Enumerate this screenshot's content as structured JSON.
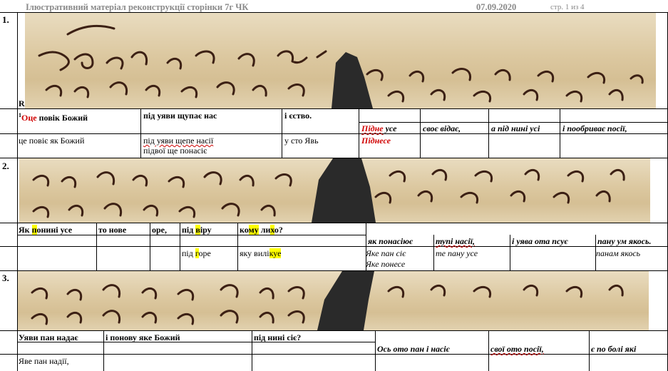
{
  "header": {
    "title": "Ілюстративний матеріал реконструкції сторінки 7г  ЧК",
    "date": "07.09.2020",
    "page": "стр. 1 из 4"
  },
  "sections": [
    {
      "number": "1.",
      "marker": "R",
      "row1": {
        "sup": "1",
        "c1_red": "Оце",
        "c1_rest": " повік Божий",
        "c2": "під уяви щупає нас",
        "c3": "і єство."
      },
      "row2_it": {
        "c1_red": "Підне",
        "c1_rest": " усе",
        "c2": "своє відає,",
        "c3": "а під нині усі",
        "c4": "і пообриває посії,"
      },
      "row3": {
        "c1": "це повіє як Божий",
        "c2_a": "під уяви щепе насії",
        "c2_b": "підвої ще понасіє",
        "c3": "у сто Явь",
        "c4_red": "Піднесе"
      }
    },
    {
      "number": "2.",
      "row1": {
        "c1_a": "Як ",
        "c1_hl": "п",
        "c1_b": "онині усе",
        "c2": "то нове",
        "c3": "оре,",
        "c4_a": "під ",
        "c4_hl": "в",
        "c4_b": "іру",
        "c5_a": "ко",
        "c5_hl1": "му",
        "c5_b": " ли",
        "c5_hl2": "х",
        "c5_c": "о?"
      },
      "row2_it": {
        "c1": "як понасіює",
        "c2": "тупі насії,",
        "c3": "і уява ота псує",
        "c4": "пану ум якось."
      },
      "row3": {
        "c1_a": "під ",
        "c1_hl": "г",
        "c1_b": "оре",
        "c2_a": "яку вилі",
        "c2_hl": "куе",
        "c3_a": "Яке пан сіє",
        "c3_b": "Яке понесе",
        "c4": "те пану усе",
        "c5": "панам якось"
      }
    },
    {
      "number": "3.",
      "row1": {
        "c1": "Уяви пан надає",
        "c2": "і понову яке Божий",
        "c3": "під нині сіє?"
      },
      "row2_it": {
        "c1": "Ось ото пан і насіє",
        "c2": "свої ото посії,",
        "c3": "є по болі які"
      },
      "row3": {
        "c1": "Яве пан надії,"
      }
    }
  ]
}
